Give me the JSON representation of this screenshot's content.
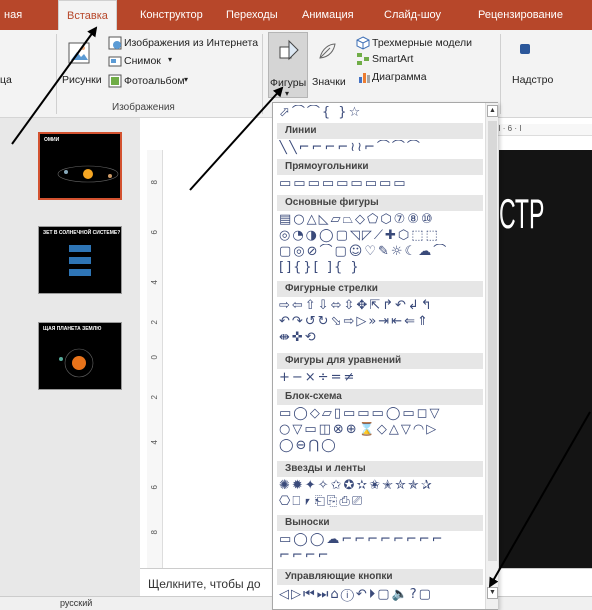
{
  "ribbon_tabs": [
    {
      "label": "ная",
      "active": false
    },
    {
      "label": "Вставка",
      "active": true
    },
    {
      "label": "Конструктор",
      "active": false
    },
    {
      "label": "Переходы",
      "active": false
    },
    {
      "label": "Анимация",
      "active": false
    },
    {
      "label": "Слайд-шоу",
      "active": false
    },
    {
      "label": "Рецензирование",
      "active": false
    }
  ],
  "ribbon": {
    "images_group": {
      "online_images": "Изображения из Интернета",
      "screenshot": "Снимок",
      "screenshot_caret": "▾",
      "photo_album": "Фотоальбом",
      "photo_album_caret": "▾",
      "pictures": "Рисунки",
      "left_cut_label": "ца",
      "caption": "Изображения"
    },
    "illustrations_group": {
      "shapes": "Фигуры",
      "icons": "Значки",
      "models_3d": "Трехмерные модели",
      "smartart": "SmartArt",
      "chart": "Диаграмма",
      "shapes_caret": "▾"
    },
    "addins": "Надстро"
  },
  "slides": [
    {
      "number": "",
      "title": "ОМИИ",
      "selected": true
    },
    {
      "number": "",
      "title": "ЗЕТ В СОЛНЕЧНОЙ СИСТЕМЕ?",
      "selected": false
    },
    {
      "number": "",
      "title": "ЩАЯ ПЛАНЕТА ЗЕМЛЮ",
      "selected": false
    }
  ],
  "ruler_labels": [
    "8",
    "6",
    "4",
    "2",
    "0",
    "2",
    "4",
    "6",
    "8"
  ],
  "hruler_text": "I · I · 6 · I",
  "main_slide_text": "СТР",
  "notes_placeholder": "Щелкните, чтобы до",
  "status_language": "русский",
  "gallery": {
    "recent_row": "⬀⌒⌒{ }☆",
    "categories": [
      {
        "name": "Линии",
        "rows": [
          "╲╲⌐⌐⌐⌐≀≀⌐⌒⌒⌒"
        ]
      },
      {
        "name": "Прямоугольники",
        "rows": [
          "▭▭▭▭▭▭▭▭▭"
        ]
      },
      {
        "name": "Основные фигуры",
        "rows": [
          "▤○△◺▱⏢◇⬠⬡⑦⑧⑩",
          "◎◔◑◯▢◹◸⟋✚⬡⬚⬚",
          "▢◎⊘⌒▢☺♡✎☼☾☁⌒",
          "[]{}[ ]{ }"
        ]
      },
      {
        "name": "Фигурные стрелки",
        "rows": [
          "⇨⇦⇧⇩⬄⇳✥⇱↱↶↲↰",
          "↶↷↺↻⬂⇨▷»⇥⇤⇐⇑",
          "⇼✜⟲"
        ]
      },
      {
        "name": "Фигуры для уравнений",
        "rows": [
          "+−×÷=≠"
        ]
      },
      {
        "name": "Блок-схема",
        "rows": [
          "▭◯◇▱▯▭▭▭◯▭◻▽",
          "○▽▭◫⊗⊕⌛◇△▽◠▷",
          "◯⊖⋂◯"
        ]
      },
      {
        "name": "Звезды и ленты",
        "rows": [
          "✺✹✦✧✩✪✫✬✭✮✯✰",
          "⎔⎕⎖⎗⎘⎙⎚"
        ]
      },
      {
        "name": "Выноски",
        "rows": [
          "▭◯◯☁⌐⌐⌐⌐⌐⌐⌐⌐",
          "⌐⌐⌐⌐"
        ]
      },
      {
        "name": "Управляющие кнопки",
        "rows": [
          "◁▷⏮⏭⌂ⓘ↶⏵▢🔈?▢"
        ]
      }
    ],
    "scroll_up": "▲",
    "scroll_down": "▼"
  },
  "colors": {
    "ribbon_tab_bg": "#b7472a",
    "ribbon_bg": "#f3f3f3",
    "gallery_header_bg": "#e6e6e6",
    "shape_stroke": "#3a4a7a",
    "selected_slide_border": "#d35230"
  }
}
